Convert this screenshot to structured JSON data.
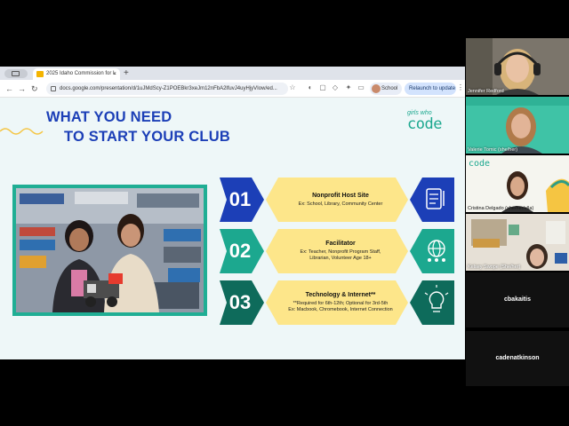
{
  "browser": {
    "tab_title": "2025 Idaho Commission for L",
    "tab_close": "×",
    "new_tab": "+",
    "url": "docs.google.com/presentation/d/1uJMdScy-Z1POEBkr3xeJm12nFbA2lfuvJ4uyHjyVIow/ed...",
    "profile_label": "School",
    "relaunch_label": "Relaunch to update",
    "menu_glyph": "⋮",
    "back_glyph": "←",
    "forward_glyph": "→",
    "reload_glyph": "↻",
    "star_glyph": "☆"
  },
  "slide": {
    "title_line1": "WHAT YOU NEED",
    "title_line2": "TO START YOUR CLUB",
    "logo_small": "girls who",
    "logo_big": "code",
    "items": [
      {
        "number": "01",
        "heading": "Nonprofit Host Site",
        "lines": [
          "Ex: School, Library, Community Center"
        ],
        "icon": "checklist-icon"
      },
      {
        "number": "02",
        "heading": "Facilitator",
        "lines": [
          "Ex: Teacher, Nonprofit Program Staff,",
          "Librarian, Volunteer Age 18+"
        ],
        "icon": "people-network-icon"
      },
      {
        "number": "03",
        "heading": "Technology & Internet**",
        "lines": [
          "**Required for 6th-12th; Optional for 3rd-5th",
          "Ex: Macbook, Chromebook, Internet Connection"
        ],
        "icon": "lightbulb-icon"
      }
    ],
    "colors": {
      "blue": "#1c3fb7",
      "teal": "#1ca88f",
      "yellow": "#fde68a",
      "dark_teal": "#0e6b5b"
    }
  },
  "participants": [
    {
      "name": "Jennifer Redford"
    },
    {
      "name": "Valerie Tomic (she/her)"
    },
    {
      "name": "Cristina Delgado (she/her/ella)"
    },
    {
      "name": "Kelsey Swope (She/her)"
    },
    {
      "name": "cbakaitis"
    },
    {
      "name": "cadenatkinson"
    }
  ]
}
